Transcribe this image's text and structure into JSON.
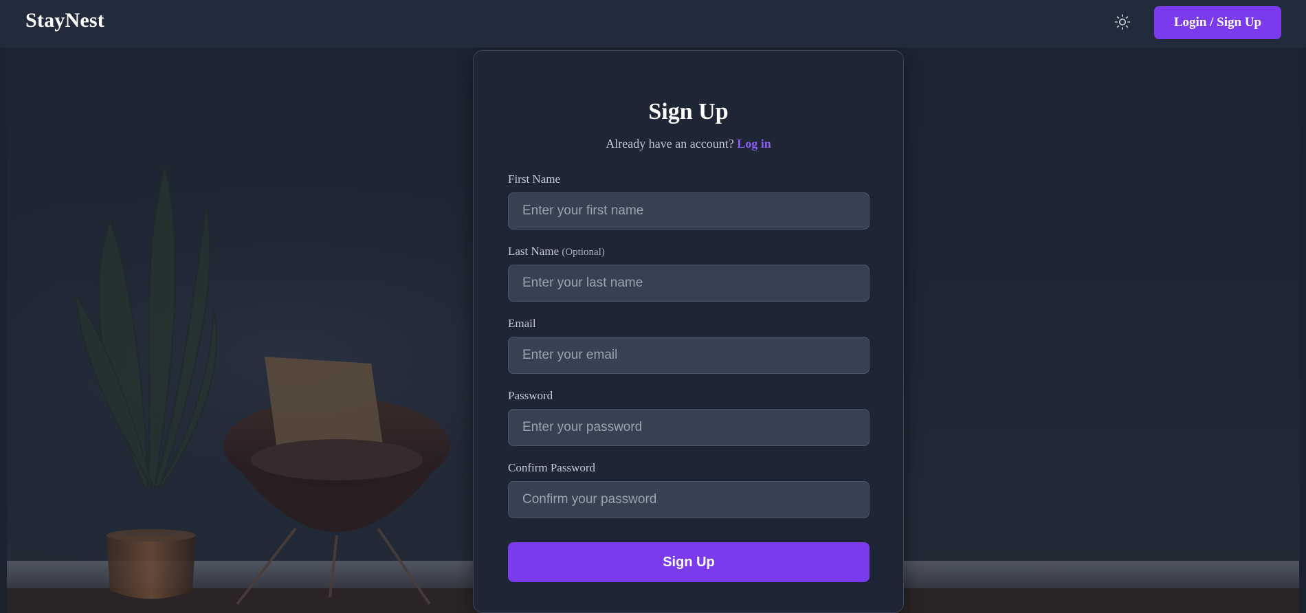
{
  "header": {
    "logo": "StayNest",
    "theme_icon": "sun-icon",
    "login_label": "Login / Sign Up"
  },
  "signup": {
    "title": "Sign Up",
    "subtitle_prefix": "Already have an account?",
    "login_link": "Log in",
    "fields": [
      {
        "label": "First Name",
        "optional": "",
        "placeholder": "Enter your first name",
        "value": ""
      },
      {
        "label": "Last Name",
        "optional": "(Optional)",
        "placeholder": "Enter your last name",
        "value": ""
      },
      {
        "label": "Email",
        "optional": "",
        "placeholder": "Enter your email",
        "value": ""
      },
      {
        "label": "Password",
        "optional": "",
        "placeholder": "Enter your password",
        "value": ""
      },
      {
        "label": "Confirm Password",
        "optional": "",
        "placeholder": "Confirm your password",
        "value": ""
      }
    ],
    "submit_label": "Sign Up"
  },
  "colors": {
    "accent": "#7c3aed",
    "link": "#8b5cf6",
    "header_bg": "#222b3b",
    "card_bg": "#1e2636",
    "input_bg": "#374152"
  }
}
